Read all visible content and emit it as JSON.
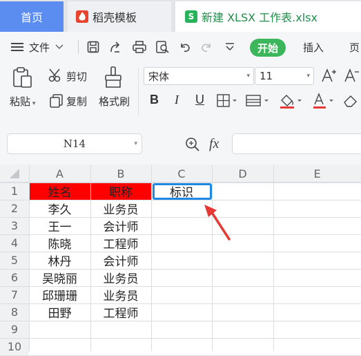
{
  "tabs": {
    "home": "首页",
    "template": "稻壳模板",
    "file": "新建 XLSX 工作表.xlsx"
  },
  "menu": {
    "file": "文件",
    "start": "开始",
    "insert": "插入",
    "page_partial": "页"
  },
  "ribbon": {
    "cut": "剪切",
    "paste": "粘贴",
    "copy": "复制",
    "format_painter": "格式刷",
    "font_name": "宋体",
    "font_size": "11",
    "bold": "B",
    "italic": "I",
    "underline": "U"
  },
  "formula_bar": {
    "name_box": "N14",
    "fx": "fx"
  },
  "sheet": {
    "columns": [
      "A",
      "B",
      "C",
      "D",
      "E"
    ],
    "rows": [
      "1",
      "2",
      "3",
      "4",
      "5",
      "6",
      "7",
      "8",
      "9",
      "10"
    ],
    "header_a": "姓名",
    "header_b": "职称",
    "header_c": "标识",
    "names": [
      "李久",
      "王一",
      "陈晓",
      "林丹",
      "吴晓丽",
      "邱珊珊",
      "田野"
    ],
    "titles": [
      "业务员",
      "会计师",
      "工程师",
      "会计师",
      "业务员",
      "业务员",
      "工程师"
    ],
    "header_fill": "#ff0000",
    "selection_color": "#1e88e5",
    "arrow_color": "#e53935"
  }
}
